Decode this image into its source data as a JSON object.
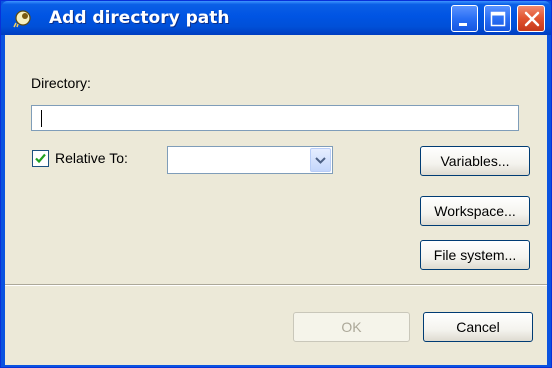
{
  "window": {
    "title": "Add directory path",
    "icon": "eclipse-icon",
    "controls": [
      "minimize-icon",
      "maximize-icon",
      "close-icon"
    ]
  },
  "form": {
    "directory_label": "Directory:",
    "directory_value": "",
    "relative_to": {
      "label": "Relative To:",
      "checked": true,
      "selected_value": ""
    },
    "buttons": {
      "variables": "Variables...",
      "workspace": "Workspace...",
      "file_system": "File system..."
    }
  },
  "footer": {
    "ok_label": "OK",
    "ok_enabled": false,
    "cancel_label": "Cancel"
  },
  "colors": {
    "titlebar": "#0054e3",
    "dialog_bg": "#ece9d8",
    "close_button": "#e1532f"
  }
}
